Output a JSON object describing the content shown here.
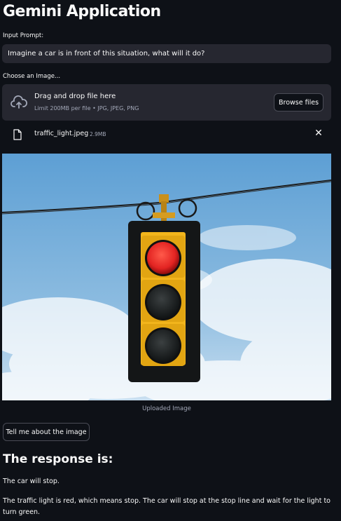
{
  "app": {
    "title": "Gemini Application"
  },
  "prompt": {
    "label": "Input Prompt:",
    "value": "Imagine a car is in front of this situation, what will it do?"
  },
  "uploader": {
    "label": "Choose an Image...",
    "drop_text": "Drag and drop file here",
    "limit_text": "Limit 200MB per file • JPG, JPEG, PNG",
    "browse_label": "Browse files",
    "icon": "cloud-upload-icon"
  },
  "file": {
    "name": "traffic_light.jpeg",
    "size": "2.9MB",
    "icon": "file-icon",
    "remove_icon": "close-icon",
    "remove_glyph": "✕"
  },
  "image": {
    "caption": "Uploaded Image",
    "active_signal": "red",
    "colors": {
      "sky": "#6aa8d8",
      "housing": "#f2b51c",
      "red_lamp": "#e32422"
    }
  },
  "action": {
    "button_label": "Tell me about the image"
  },
  "response": {
    "heading": "The response is:",
    "paragraphs": [
      "The car will stop.",
      "The traffic light is red, which means stop. The car will stop at the stop line and wait for the light to turn green."
    ]
  },
  "colors": {
    "background": "#0e1117",
    "input_bg": "#262730",
    "text": "#fafafa",
    "muted": "#a3a8b8"
  }
}
